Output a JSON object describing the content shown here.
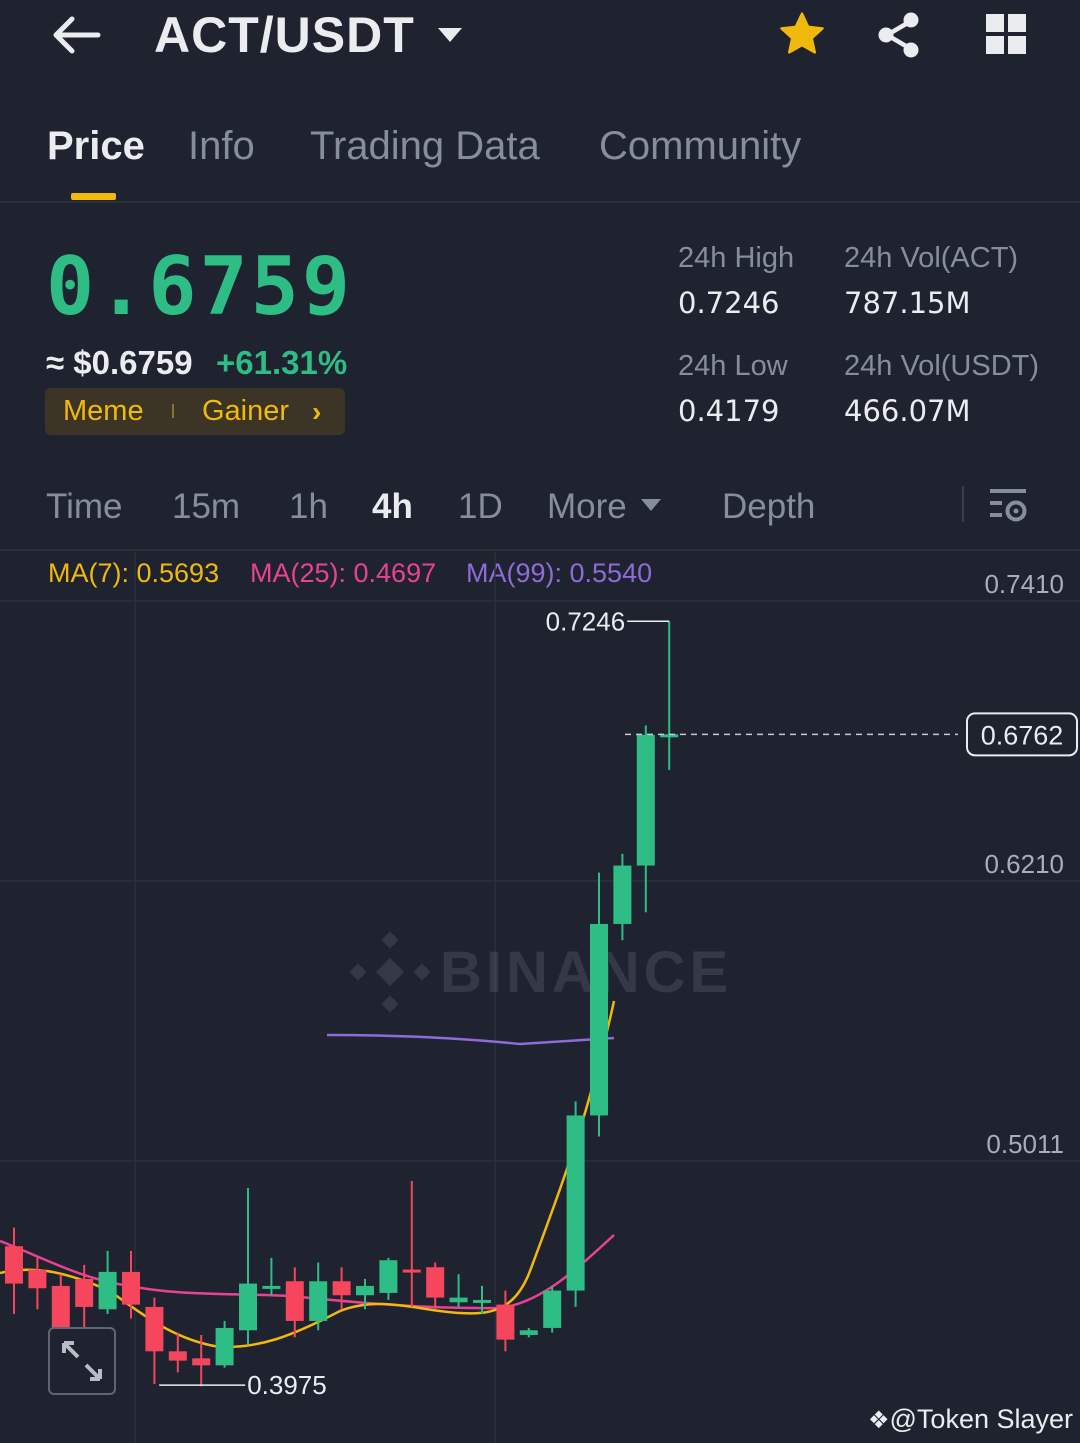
{
  "header": {
    "pair": "ACT/USDT",
    "icons": [
      "back-arrow-icon",
      "caret-down-icon",
      "star-icon",
      "share-icon",
      "grid-icon"
    ]
  },
  "tabs": [
    {
      "label": "Price",
      "active": true
    },
    {
      "label": "Info"
    },
    {
      "label": "Trading Data"
    },
    {
      "label": "Community"
    }
  ],
  "price": {
    "last": "0.6759",
    "usd": "≈ $0.6759",
    "change": "+61.31%",
    "tags": [
      "Meme",
      "Gainer"
    ]
  },
  "stats": {
    "high_label": "24h High",
    "high_value": "0.7246",
    "vol_base_label": "24h Vol(ACT)",
    "vol_base_value": "787.15M",
    "low_label": "24h Low",
    "low_value": "0.4179",
    "vol_quote_label": "24h Vol(USDT)",
    "vol_quote_value": "466.07M"
  },
  "intervals": [
    {
      "label": "Time"
    },
    {
      "label": "15m"
    },
    {
      "label": "1h"
    },
    {
      "label": "4h",
      "active": true
    },
    {
      "label": "1D"
    },
    {
      "label": "More"
    },
    {
      "label": "Depth"
    }
  ],
  "ma": {
    "ma7": "MA(7): 0.5693",
    "ma25": "MA(25): 0.4697",
    "ma99": "MA(99): 0.5540"
  },
  "colors": {
    "up": "#2ebd85",
    "down": "#f6465d",
    "accent": "#f0b90b",
    "ma7": "#f0b90b",
    "ma25": "#e84393",
    "ma99": "#8e6bd8"
  },
  "chart_data": {
    "type": "candlestick",
    "price_axis_labels": [
      "0.7410",
      "0.6210",
      "0.5011"
    ],
    "current_price_label": "0.6762",
    "high_marker": "0.7246",
    "low_marker": "0.3975",
    "watermark": "BINANCE",
    "candles": [
      {
        "o": 0.457,
        "h": 0.465,
        "l": 0.428,
        "c": 0.441
      },
      {
        "o": 0.447,
        "h": 0.452,
        "l": 0.43,
        "c": 0.439
      },
      {
        "o": 0.44,
        "h": 0.445,
        "l": 0.402,
        "c": 0.405
      },
      {
        "o": 0.443,
        "h": 0.449,
        "l": 0.42,
        "c": 0.431
      },
      {
        "o": 0.43,
        "h": 0.455,
        "l": 0.428,
        "c": 0.446
      },
      {
        "o": 0.446,
        "h": 0.455,
        "l": 0.426,
        "c": 0.432
      },
      {
        "o": 0.431,
        "h": 0.435,
        "l": 0.398,
        "c": 0.412
      },
      {
        "o": 0.412,
        "h": 0.42,
        "l": 0.403,
        "c": 0.408
      },
      {
        "o": 0.409,
        "h": 0.419,
        "l": 0.397,
        "c": 0.406
      },
      {
        "o": 0.406,
        "h": 0.425,
        "l": 0.405,
        "c": 0.422
      },
      {
        "o": 0.421,
        "h": 0.482,
        "l": 0.415,
        "c": 0.441
      },
      {
        "o": 0.439,
        "h": 0.452,
        "l": 0.436,
        "c": 0.44
      },
      {
        "o": 0.442,
        "h": 0.448,
        "l": 0.418,
        "c": 0.425
      },
      {
        "o": 0.425,
        "h": 0.45,
        "l": 0.421,
        "c": 0.442
      },
      {
        "o": 0.442,
        "h": 0.448,
        "l": 0.43,
        "c": 0.436
      },
      {
        "o": 0.436,
        "h": 0.443,
        "l": 0.43,
        "c": 0.44
      },
      {
        "o": 0.437,
        "h": 0.452,
        "l": 0.434,
        "c": 0.451
      },
      {
        "o": 0.447,
        "h": 0.485,
        "l": 0.431,
        "c": 0.446
      },
      {
        "o": 0.448,
        "h": 0.45,
        "l": 0.43,
        "c": 0.435
      },
      {
        "o": 0.433,
        "h": 0.445,
        "l": 0.431,
        "c": 0.435
      },
      {
        "o": 0.433,
        "h": 0.44,
        "l": 0.428,
        "c": 0.434
      },
      {
        "o": 0.432,
        "h": 0.438,
        "l": 0.412,
        "c": 0.417
      },
      {
        "o": 0.419,
        "h": 0.422,
        "l": 0.418,
        "c": 0.421
      },
      {
        "o": 0.422,
        "h": 0.44,
        "l": 0.42,
        "c": 0.438
      },
      {
        "o": 0.438,
        "h": 0.519,
        "l": 0.431,
        "c": 0.513
      },
      {
        "o": 0.513,
        "h": 0.617,
        "l": 0.504,
        "c": 0.595
      },
      {
        "o": 0.595,
        "h": 0.625,
        "l": 0.588,
        "c": 0.62
      },
      {
        "o": 0.62,
        "h": 0.68,
        "l": 0.6,
        "c": 0.676
      },
      {
        "o": 0.676,
        "h": 0.7246,
        "l": 0.661,
        "c": 0.6762
      }
    ]
  },
  "credit": "@Token Slayer"
}
